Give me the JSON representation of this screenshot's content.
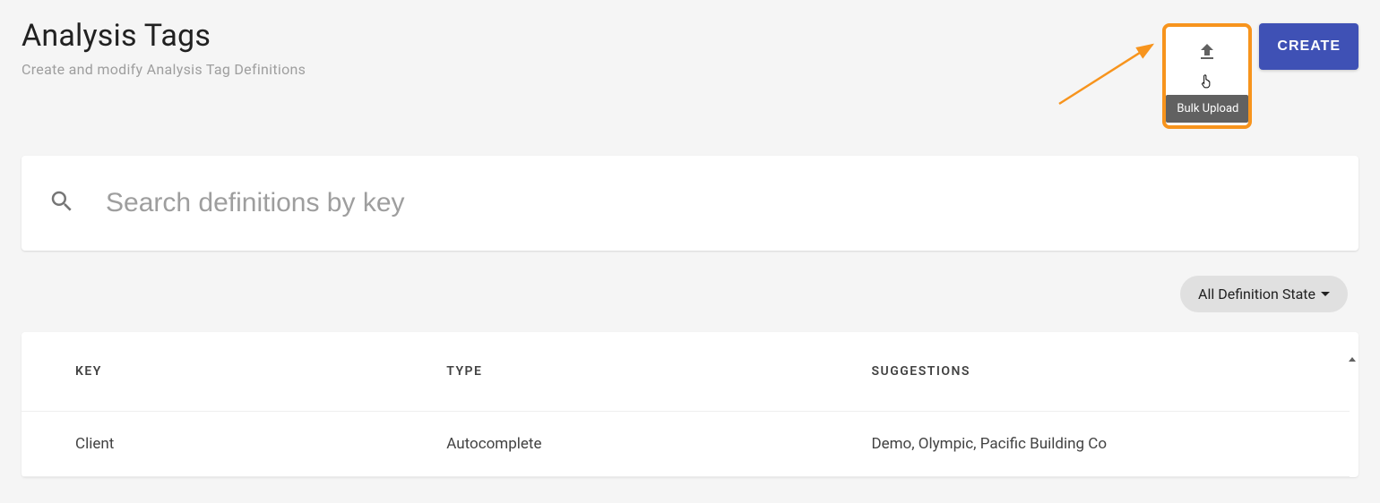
{
  "header": {
    "title": "Analysis Tags",
    "subtitle": "Create and modify Analysis Tag Definitions",
    "upload_tooltip": "Bulk Upload",
    "create_label": "CREATE"
  },
  "search": {
    "placeholder": "Search definitions by key",
    "value": ""
  },
  "filter": {
    "label": "All Definition State"
  },
  "table": {
    "headers": {
      "key": "KEY",
      "type": "TYPE",
      "suggestions": "SUGGESTIONS"
    },
    "rows": [
      {
        "key": "Client",
        "type": "Autocomplete",
        "suggestions": "Demo, Olympic, Pacific Building Co"
      }
    ]
  }
}
